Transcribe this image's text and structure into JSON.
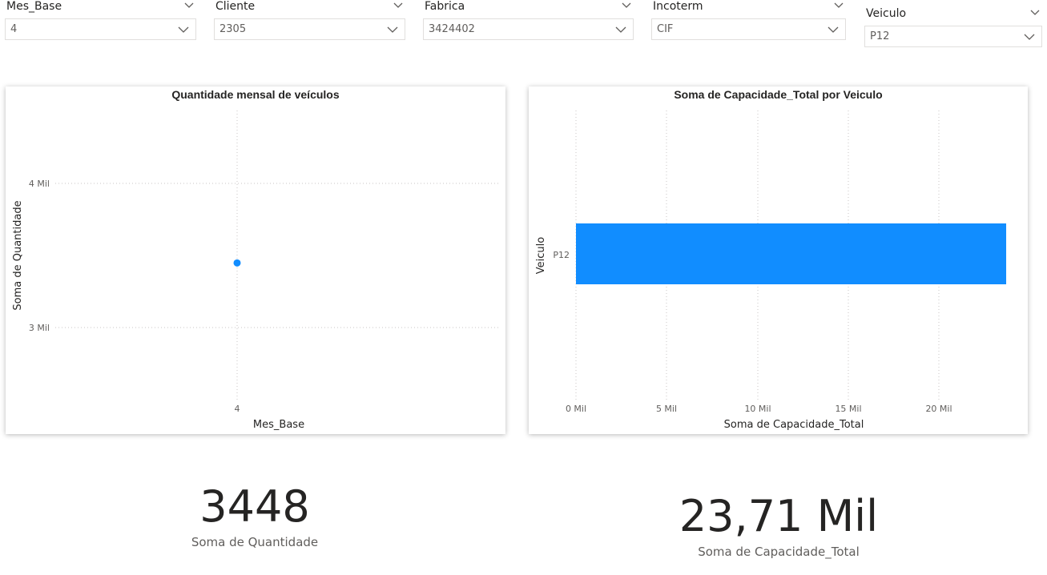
{
  "slicers": [
    {
      "title": "Mes_Base",
      "value": "4"
    },
    {
      "title": "Cliente",
      "value": "2305"
    },
    {
      "title": "Fabrica",
      "value": "3424402"
    },
    {
      "title": "Incoterm",
      "value": "CIF"
    },
    {
      "title": "Veiculo",
      "value": "P12"
    }
  ],
  "scatter": {
    "title": "Quantidade mensal de veículos",
    "ylabel": "Soma de Quantidade",
    "xlabel": "Mes_Base",
    "y_ticks": [
      "4 Mil",
      "3 Mil"
    ],
    "x_ticks": [
      "4"
    ]
  },
  "bar": {
    "title": "Soma de Capacidade_Total por Veiculo",
    "ylabel": "Veiculo",
    "xlabel": "Soma de Capacidade_Total",
    "categories": [
      "P12"
    ],
    "x_ticks": [
      "0 Mil",
      "5 Mil",
      "10 Mil",
      "15 Mil",
      "20 Mil"
    ]
  },
  "cards": [
    {
      "value": "3448",
      "label": "Soma de Quantidade"
    },
    {
      "value": "23,71 Mil",
      "label": "Soma de Capacidade_Total"
    }
  ],
  "chart_data": [
    {
      "type": "scatter",
      "title": "Quantidade mensal de veículos",
      "xlabel": "Mes_Base",
      "ylabel": "Soma de Quantidade",
      "x": [
        4
      ],
      "y": [
        3448
      ],
      "ylim": [
        2500,
        4500
      ],
      "grid": true,
      "color": "#118DFF"
    },
    {
      "type": "bar",
      "orientation": "horizontal",
      "title": "Soma de Capacidade_Total por Veiculo",
      "xlabel": "Soma de Capacidade_Total",
      "ylabel": "Veiculo",
      "categories": [
        "P12"
      ],
      "values": [
        23710
      ],
      "xlim": [
        0,
        23710
      ],
      "grid": true,
      "color": "#118DFF"
    }
  ]
}
